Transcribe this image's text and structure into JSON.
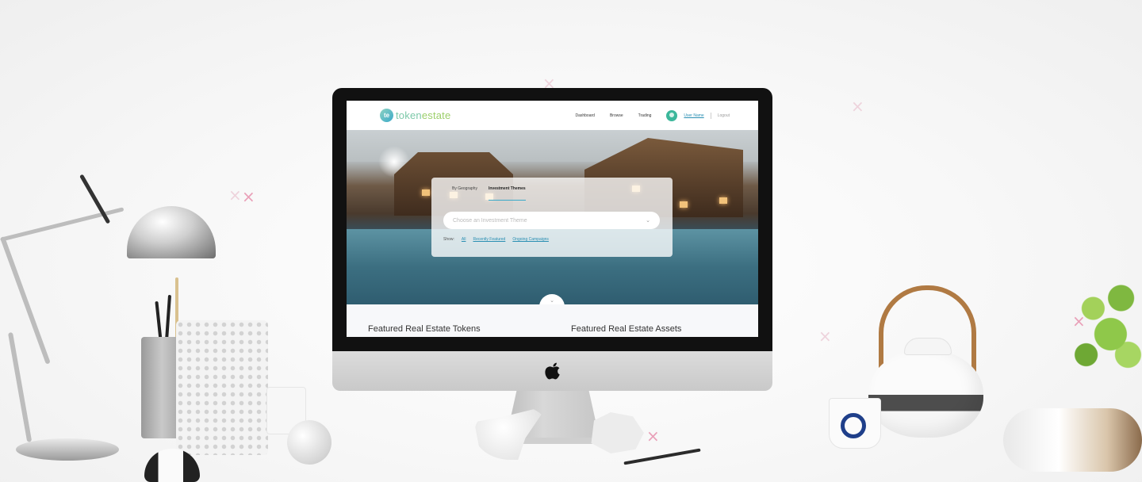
{
  "site": {
    "logo": {
      "badge": "te",
      "text_a": "token",
      "text_b": "estate"
    },
    "nav": [
      {
        "label": "Dashboard"
      },
      {
        "label": "Browse"
      },
      {
        "label": "Trading"
      }
    ],
    "user": {
      "name": "User Name",
      "logout": "Logout"
    }
  },
  "search": {
    "tabs": [
      {
        "label": "By Geography",
        "active": false
      },
      {
        "label": "Investment Themes",
        "active": true
      }
    ],
    "select_placeholder": "Choose an Investment Theme",
    "show_label": "Show:",
    "filters": [
      {
        "label": "All"
      },
      {
        "label": "Recently Featured"
      },
      {
        "label": "Ongoing Campaigns"
      }
    ]
  },
  "sections": {
    "tokens_title": "Featured Real Estate Tokens",
    "assets_title": "Featured Real Estate Assets"
  },
  "colors": {
    "accent": "#3aa9c9",
    "logo_green": "#7dc9a9",
    "link": "#2a8fb3",
    "decor_x": "#e9a0b8"
  },
  "icons": {
    "chevron": "chevron-down-icon",
    "apple": "apple-logo",
    "avatar": "user-avatar-icon"
  }
}
